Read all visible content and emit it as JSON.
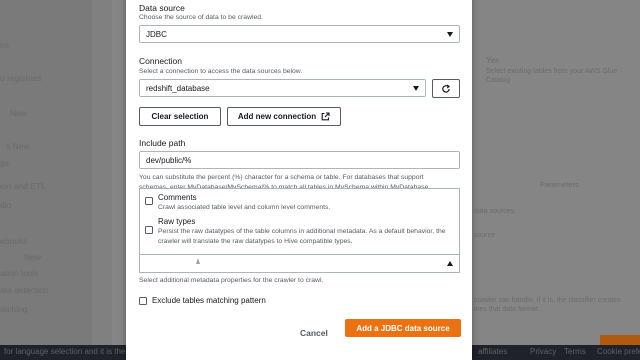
{
  "background": {
    "sidebar_items": [
      "ns",
      "o registries",
      "New",
      "s New",
      "gs",
      "ion and ETL",
      "dio",
      "ebooks",
      "New",
      "ation tools",
      "ata detection",
      "atching"
    ],
    "right_texts": [
      "Yes",
      "Select existing tables from your AWS Glue",
      "Catalog",
      "Parameters",
      "data sources.",
      "source",
      "crawler can handle. If it is, the classifier creates",
      "ines that data format."
    ],
    "footer_items": [
      "Privacy",
      "Terms",
      "Cookie prefe",
      "affiliates"
    ],
    "footer_left": "for language selection and it is the default language"
  },
  "modal": {
    "data_source": {
      "label": "Data source",
      "description": "Choose the source of data to be crawled.",
      "value": "JDBC"
    },
    "connection": {
      "label": "Connection",
      "description": "Select a connection to access the data sources below.",
      "value": "redshift_database",
      "refresh_icon": "refresh-icon"
    },
    "buttons": {
      "clear": "Clear selection",
      "add_connection": "Add new connection",
      "external_icon": "external-link-icon"
    },
    "include_path": {
      "label": "Include path",
      "value": "dev/public/%",
      "hint_line1": "You can substitute the percent (%) character for a schema or table. For databases that support",
      "hint_line2": "schemas, enter MyDatabase/MySchema/% to match all tables in MySchema within MyDatabase."
    },
    "metadata_options": [
      {
        "title": "Comments",
        "description": "Crawl associated table level and column level comments.",
        "checked": false
      },
      {
        "title": "Raw types",
        "description": "Persist the raw datatypes of the table columns in additional metadata. As a default behavior, the crawler will translate the raw datatypes to Hive compatible types.",
        "checked": false
      }
    ],
    "metadata_hint": "Select additional metadata properties for the crawler to crawl.",
    "exclude_label": "Exclude tables matching pattern",
    "cancel": "Cancel",
    "submit": "Add a JDBC data source"
  },
  "colors": {
    "accent": "#ec7211",
    "text": "#16191f",
    "secondary_text": "#545b64",
    "border": "#aab7b8"
  }
}
